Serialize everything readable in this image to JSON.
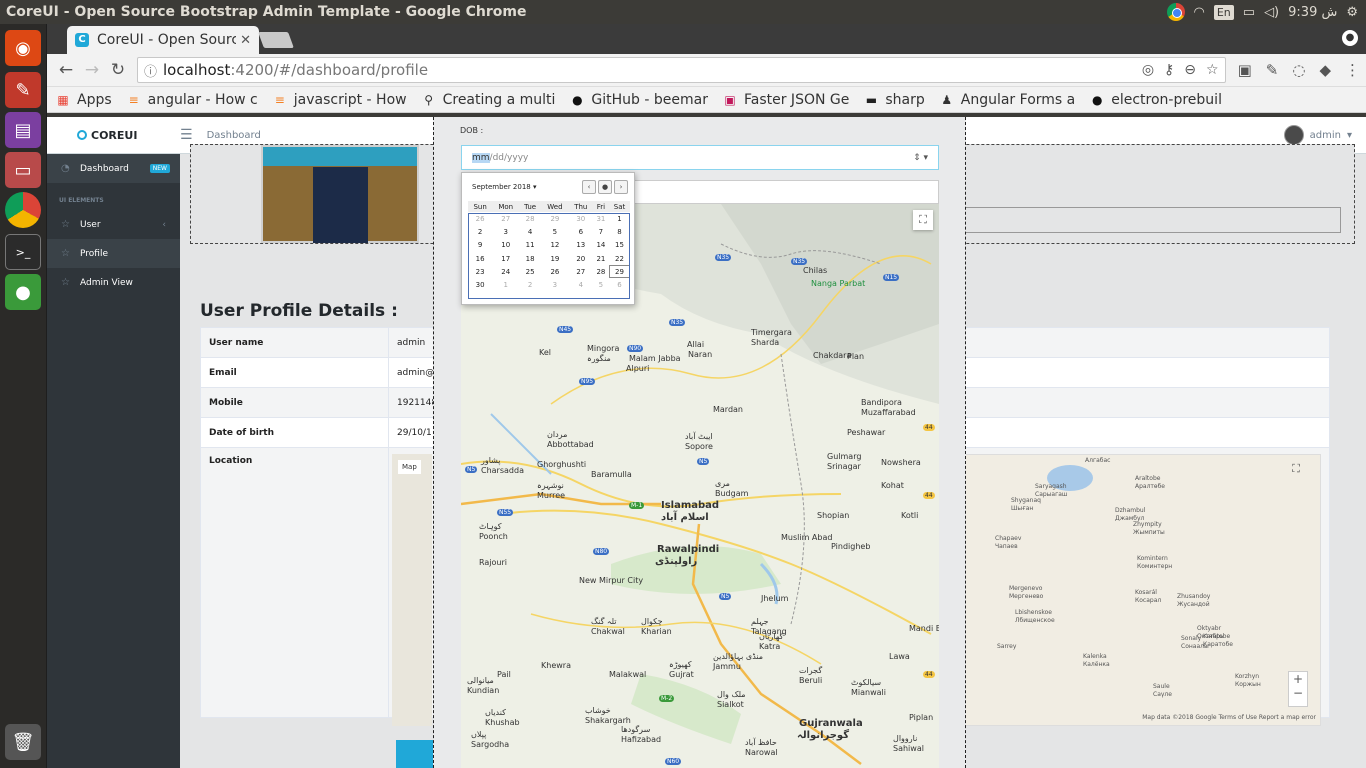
{
  "os": {
    "window_title": "CoreUI - Open Source Bootstrap Admin Template - Google Chrome",
    "lang": "En",
    "clock": "9:39 ش",
    "launcher": [
      "ubuntu-icon",
      "settings-icon",
      "workspaces-icon",
      "files-icon",
      "chrome-icon",
      "terminal-icon",
      "app-icon",
      "trash-icon"
    ]
  },
  "browser": {
    "tab_title": "CoreUI - Open Sourc",
    "tab_favicon": "C",
    "url_host": "localhost",
    "url_path": ":4200/#/dashboard/profile",
    "bookmarks": [
      {
        "label": "Apps",
        "icon": "grid-icon"
      },
      {
        "label": "angular - How c",
        "icon": "stackoverflow-icon"
      },
      {
        "label": "javascript - How",
        "icon": "stackoverflow-icon"
      },
      {
        "label": "Creating a multi",
        "icon": "bike-icon"
      },
      {
        "label": "GitHub - beemar",
        "icon": "github-icon"
      },
      {
        "label": "Faster JSON Ge",
        "icon": "json-icon"
      },
      {
        "label": "sharp",
        "icon": "book-icon"
      },
      {
        "label": "Angular Forms a",
        "icon": "user-icon"
      },
      {
        "label": "electron-prebuil",
        "icon": "github-icon"
      }
    ]
  },
  "app": {
    "logo": "COREUI",
    "breadcrumb": "Dashboard",
    "user": "admin",
    "sidebar": {
      "dashboard": "Dashboard",
      "badge": "NEW",
      "section": "UI ELEMENTS",
      "items": [
        "User",
        "Profile",
        "Admin View"
      ]
    },
    "heading": "User Profile Details :",
    "rows": [
      {
        "k": "User name",
        "v": "admin"
      },
      {
        "k": "Email",
        "v": "admin@"
      },
      {
        "k": "Mobile",
        "v": "1921148"
      },
      {
        "k": "Date of birth",
        "v": "29/10/1"
      },
      {
        "k": "Location",
        "v": ""
      }
    ],
    "small_map_btn": "Map"
  },
  "form": {
    "dob_label": "DOB :",
    "dob_mm": "mm",
    "dob_rest": "/dd/yyyy",
    "picker": {
      "month": "September 2018",
      "days": [
        "Sun",
        "Mon",
        "Tue",
        "Wed",
        "Thu",
        "Fri",
        "Sat"
      ],
      "weeks": [
        [
          "26",
          "27",
          "28",
          "29",
          "30",
          "31",
          "1"
        ],
        [
          "2",
          "3",
          "4",
          "5",
          "6",
          "7",
          "8"
        ],
        [
          "9",
          "10",
          "11",
          "12",
          "13",
          "14",
          "15"
        ],
        [
          "16",
          "17",
          "18",
          "19",
          "20",
          "21",
          "22"
        ],
        [
          "23",
          "24",
          "25",
          "26",
          "27",
          "28",
          "29"
        ],
        [
          "30",
          "1",
          "2",
          "3",
          "4",
          "5",
          "6"
        ]
      ]
    }
  },
  "map_labels": {
    "big": [
      "Islamabad",
      "اسلام آباد",
      "Rawalpindi",
      "راولپنڈی",
      "Gujranwala",
      "گوجرانوالہ"
    ],
    "places": [
      "Nanga Parbat",
      "Chilas",
      "Mingora",
      "منگورہ",
      "Malam Jabba",
      "Alpuri",
      "Allai",
      "Naran",
      "Timergara",
      "Sharda",
      "Kel",
      "Chakdara",
      "Plan",
      "Bandipora",
      "Muzaffarabad",
      "Mardan",
      "مردان",
      "Abbottabad",
      "ایبٹ آباد",
      "Sopore",
      "Peshawar",
      "پشاور",
      "Charsadda",
      "Ghorghushti",
      "Baramulla",
      "Gulmarg",
      "Srinagar",
      "Nowshera",
      "نوشہرہ",
      "Murree",
      "مری",
      "Budgam",
      "Kohat",
      "کوہاٹ",
      "Poonch",
      "Shopian",
      "Kotli",
      "Muslim Abad",
      "Rajouri",
      "Pindigheb",
      "New Mirpur City",
      "Jhelum",
      "جہلم",
      "Talagang",
      "تلہ گنگ",
      "Chakwal",
      "چکوال",
      "Kharian",
      "کھاریاں",
      "Katra",
      "Mandi Bahauddin",
      "منڈی بہاؤالدین",
      "Jammu",
      "Lawa",
      "Khewra",
      "کھیوڑہ",
      "Gujrat",
      "گجرات",
      "Beruli",
      "Pail",
      "Malakwal",
      "ملک وال",
      "Sialkot",
      "سیالکوٹ",
      "Mianwali",
      "میانوالی",
      "Kundian",
      "کندیاں",
      "Khushab",
      "خوشاب",
      "Shakargarh",
      "Piplan",
      "پپلاں",
      "Sargodha",
      "سرگودھا",
      "Hafizabad",
      "حافظ آباد",
      "Narowal",
      "نارووال",
      "Sahiwal"
    ],
    "shields": [
      "N35",
      "N35",
      "N15",
      "N45",
      "N90",
      "N95",
      "N35",
      "N5",
      "N55",
      "M-1",
      "N80",
      "N5",
      "M-2",
      "N5",
      "N60",
      "44",
      "44",
      "44"
    ]
  },
  "bg_map": {
    "labels": [
      "Алгабас",
      "Saryagash",
      "Сарыагаш",
      "Araltobe",
      "Аралтөбе",
      "Shyganaq",
      "Шыған",
      "Dzhambul",
      "Джамбул",
      "Zhympity",
      "Жымпиты",
      "Chapaev",
      "Чапаев",
      "Komintern",
      "Коминтерн",
      "Mergenevo",
      "Мергенево",
      "Kosarál",
      "Косарал",
      "Zhusandoy",
      "Жусандой",
      "Lbishenskoe",
      "Лбищенское",
      "Oktyabr",
      "Октябрь",
      "Sarrey",
      "Kalenka",
      "Калёнка",
      "Sonaly",
      "Сонаалы",
      "Karatobe",
      "Каратобе",
      "Saule",
      "Саүле",
      "Korzhyn",
      "Коржын"
    ],
    "attribution": "Map data ©2018 Google   Terms of Use   Report a map error"
  },
  "colors": {
    "accent": "#20a8d8",
    "sidebar": "#2f353a",
    "page": "#e4e5e6"
  }
}
